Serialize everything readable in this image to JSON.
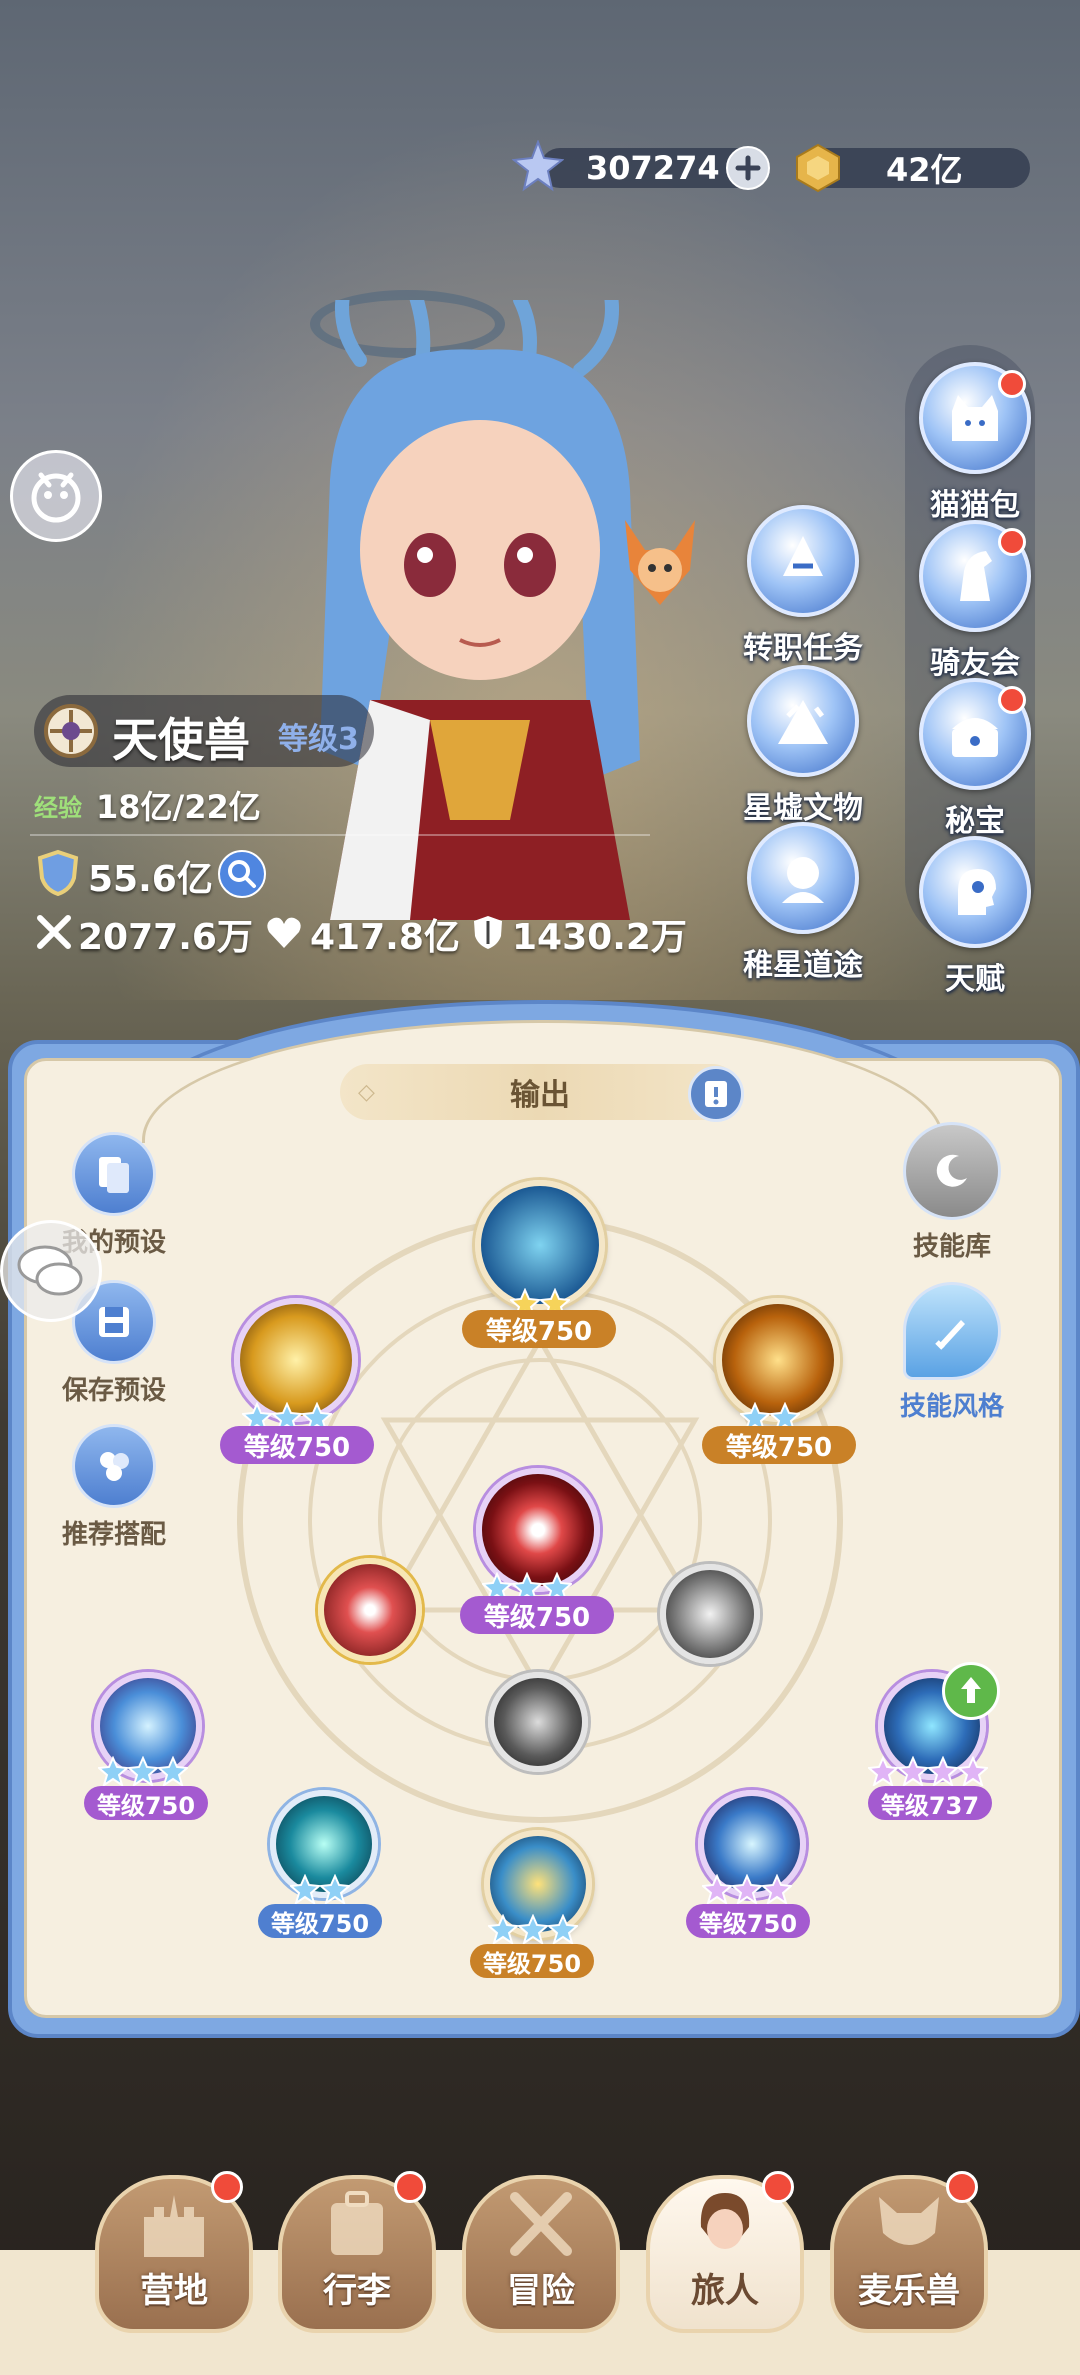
{
  "currency": {
    "star_value": "307274",
    "gold_value": "42亿"
  },
  "character": {
    "name": "天使兽",
    "level": "等级3",
    "exp_label": "经验",
    "exp_value": "18亿/22亿",
    "power": "55.6亿",
    "attack": "2077.6万",
    "hp": "417.8亿",
    "defense": "1430.2万"
  },
  "right_menu": [
    {
      "label": "猫猫包",
      "icon": "cat-bag-icon",
      "badge": true
    },
    {
      "label": "骑友会",
      "icon": "horse-icon",
      "badge": true
    },
    {
      "label": "秘宝",
      "icon": "treasure-icon",
      "badge": true
    },
    {
      "label": "天赋",
      "icon": "talent-head-icon",
      "badge": false
    }
  ],
  "mid_menu": [
    {
      "label": "转职任务",
      "icon": "job-change-icon"
    },
    {
      "label": "星墟文物",
      "icon": "relic-icon"
    },
    {
      "label": "稚星道途",
      "icon": "path-icon"
    }
  ],
  "panel": {
    "tab_label": "输出",
    "left_buttons": [
      {
        "label": "我的预设",
        "icon": "preset-icon"
      },
      {
        "label": "保存预设",
        "icon": "save-icon"
      },
      {
        "label": "推荐搭配",
        "icon": "recommend-icon"
      }
    ],
    "right_buttons": [
      {
        "label": "技能库",
        "icon": "skill-library-icon"
      },
      {
        "label": "技能风格",
        "icon": "skill-style-icon"
      }
    ],
    "skills": [
      {
        "level": "等级750",
        "stars": 2,
        "tier": "gold"
      },
      {
        "level": "等级750",
        "stars": 3,
        "tier": "purple"
      },
      {
        "level": "等级750",
        "stars": 2,
        "tier": "gold"
      },
      {
        "level": "等级750",
        "stars": 3,
        "tier": "purple"
      },
      {
        "level": "等级750",
        "stars": 3,
        "tier": "purple"
      },
      {
        "level": "等级737",
        "stars": 4,
        "tier": "purple"
      },
      {
        "level": "等级750",
        "stars": 2,
        "tier": "blue"
      },
      {
        "level": "等级750",
        "stars": 3,
        "tier": "gold"
      },
      {
        "level": "等级750",
        "stars": 3,
        "tier": "purple"
      }
    ]
  },
  "bottom_nav": [
    {
      "label": "营地",
      "icon": "castle-icon",
      "badge": true,
      "active": false
    },
    {
      "label": "行李",
      "icon": "luggage-icon",
      "badge": true,
      "active": false
    },
    {
      "label": "冒险",
      "icon": "crossed-swords-icon",
      "badge": false,
      "active": false
    },
    {
      "label": "旅人",
      "icon": "traveler-icon",
      "badge": true,
      "active": true
    },
    {
      "label": "麦乐兽",
      "icon": "pet-icon",
      "badge": true,
      "active": false
    }
  ]
}
